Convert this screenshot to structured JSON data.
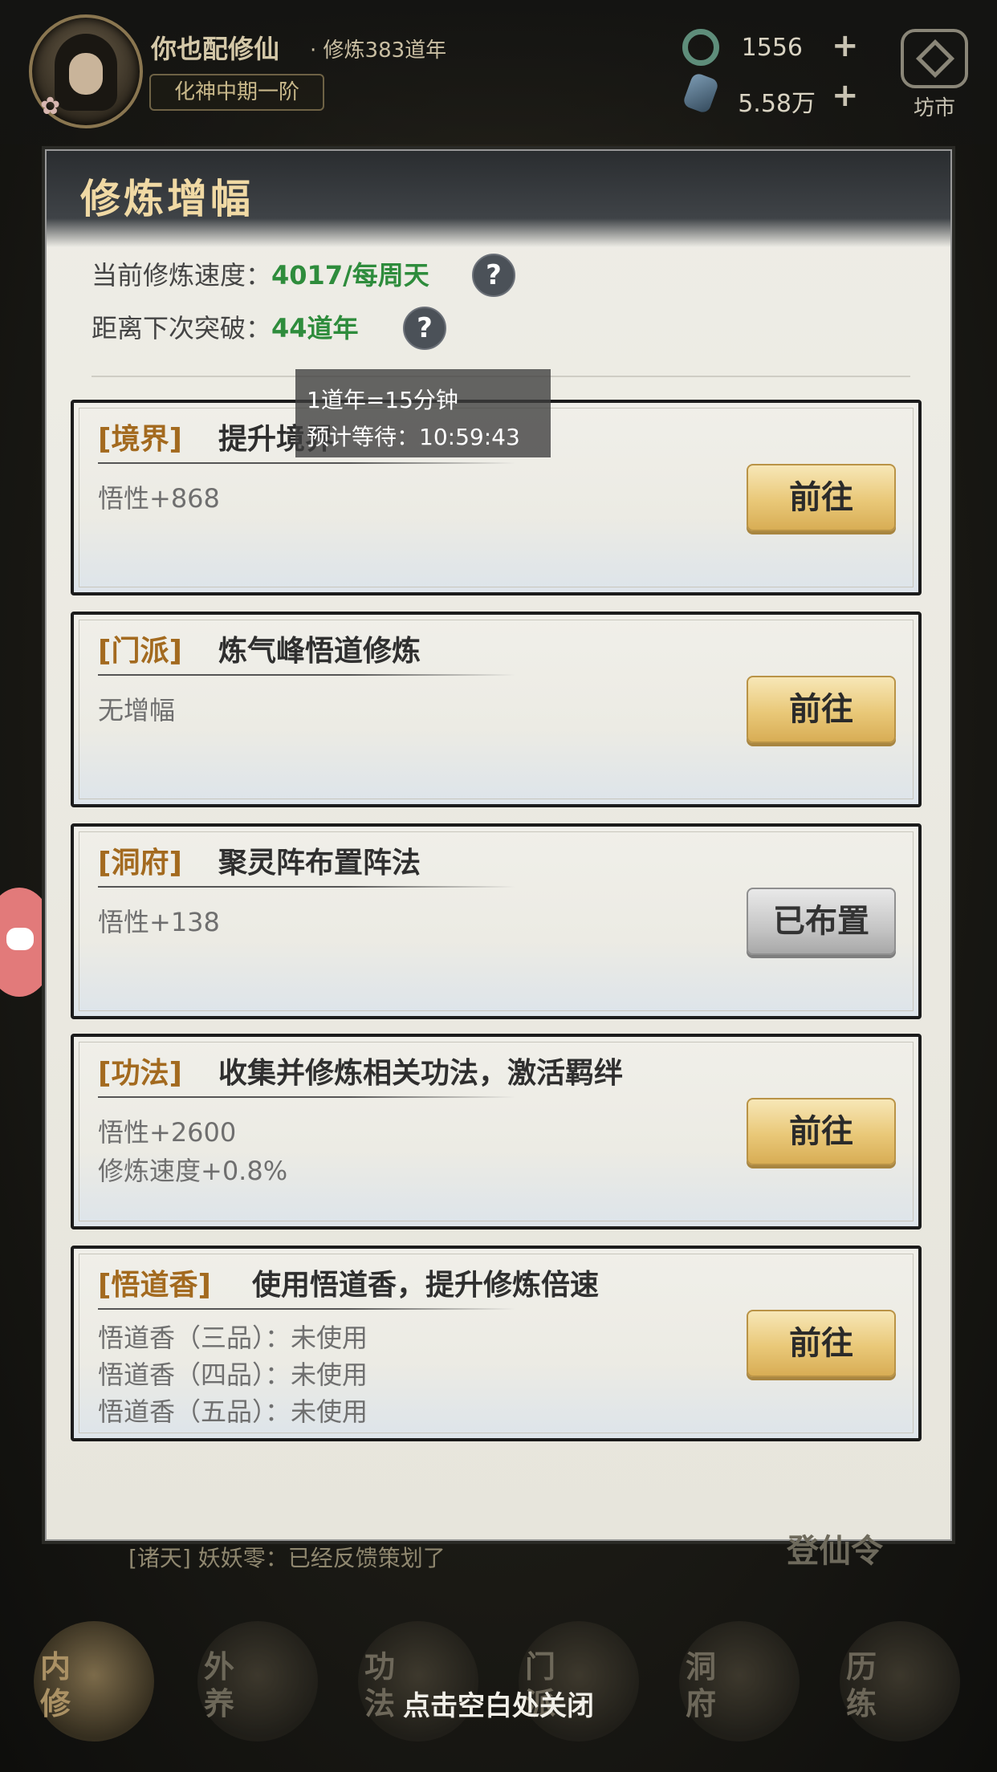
{
  "header": {
    "player_name": "你也配修仙",
    "player_sub": "· 修炼383道年",
    "realm": "化神中期一阶",
    "currency1": "1556",
    "currency2": "5.58万",
    "plus": "+",
    "market_label": "坊市"
  },
  "modal": {
    "title": "修炼增幅",
    "speed_label": "当前修炼速度：",
    "speed_value": "4017/每周天",
    "breakthrough_label": "距离下次突破：",
    "breakthrough_value": "44道年",
    "help_symbol": "?",
    "tooltip_line1": "1道年=15分钟",
    "tooltip_line2": "预计等待：10:59:43",
    "cards": [
      {
        "tag": "[境界]",
        "title": "提升境界",
        "effects": [
          "悟性+868"
        ],
        "button": "前往"
      },
      {
        "tag": "[门派]",
        "title": "炼气峰悟道修炼",
        "effects": [
          "无增幅"
        ],
        "button": "前往"
      },
      {
        "tag": "[洞府]",
        "title": "聚灵阵布置阵法",
        "effects": [
          "悟性+138"
        ],
        "button": "已布置"
      },
      {
        "tag": "[功法]",
        "title": "收集并修炼相关功法，激活羁绊",
        "effects": [
          "悟性+2600",
          "修炼速度+0.8%"
        ],
        "button": "前往"
      },
      {
        "tag": "[悟道香]",
        "title": "使用悟道香，提升修炼倍速",
        "effects": [
          "悟道香（三品）：未使用",
          "悟道香（四品）：未使用",
          "悟道香（五品）：未使用"
        ],
        "button": "前往"
      }
    ]
  },
  "chat": {
    "line": "[诸天] 妖妖零：已经反馈策划了"
  },
  "faded_title": "登仙令",
  "nav": {
    "items": [
      "内修",
      "外养",
      "功法",
      "门派",
      "洞府",
      "历练"
    ]
  },
  "close_hint": "点击空白处关闭"
}
